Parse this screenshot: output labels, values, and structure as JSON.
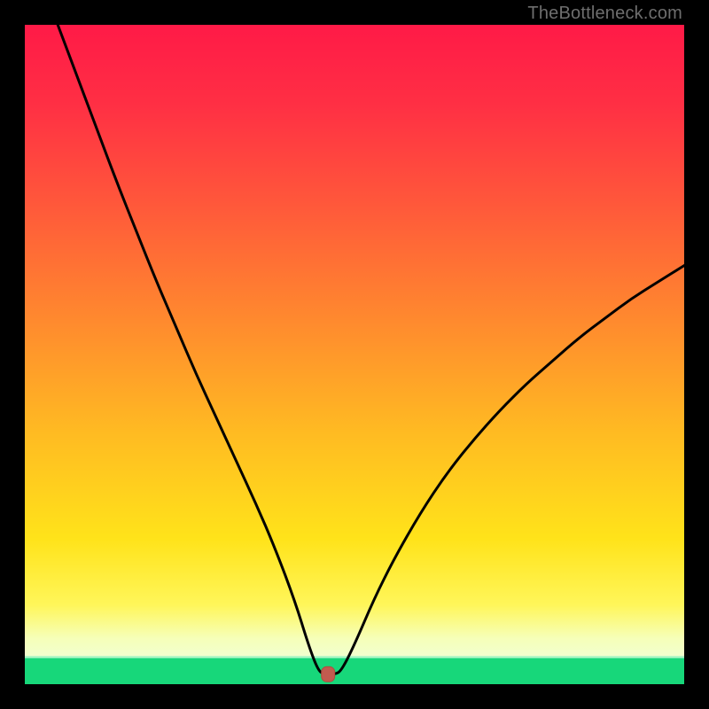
{
  "watermark": "TheBottleneck.com",
  "chart_data": {
    "type": "line",
    "title": "",
    "xlabel": "",
    "ylabel": "",
    "xlim": [
      0,
      100
    ],
    "ylim": [
      0,
      100
    ],
    "grid": false,
    "background_gradient": "red-orange-yellow-green (top→bottom)",
    "green_band_y": [
      0,
      4
    ],
    "marker": {
      "x": 46,
      "y": 1.5,
      "color": "#c15b4f",
      "shape": "rounded-rect"
    },
    "curve_points": [
      {
        "x": 5.0,
        "y": 100.0
      },
      {
        "x": 8.0,
        "y": 92.0
      },
      {
        "x": 11.0,
        "y": 84.0
      },
      {
        "x": 14.0,
        "y": 76.0
      },
      {
        "x": 17.0,
        "y": 68.5
      },
      {
        "x": 20.0,
        "y": 61.0
      },
      {
        "x": 23.0,
        "y": 54.0
      },
      {
        "x": 26.0,
        "y": 47.0
      },
      {
        "x": 29.0,
        "y": 40.5
      },
      {
        "x": 32.0,
        "y": 34.0
      },
      {
        "x": 35.0,
        "y": 27.5
      },
      {
        "x": 38.0,
        "y": 20.5
      },
      {
        "x": 41.0,
        "y": 12.5
      },
      {
        "x": 43.0,
        "y": 6.0
      },
      {
        "x": 44.5,
        "y": 2.0
      },
      {
        "x": 45.5,
        "y": 1.5
      },
      {
        "x": 47.0,
        "y": 1.5
      },
      {
        "x": 48.0,
        "y": 2.0
      },
      {
        "x": 50.0,
        "y": 6.0
      },
      {
        "x": 53.0,
        "y": 13.0
      },
      {
        "x": 56.0,
        "y": 19.0
      },
      {
        "x": 60.0,
        "y": 26.0
      },
      {
        "x": 64.0,
        "y": 32.0
      },
      {
        "x": 68.0,
        "y": 37.0
      },
      {
        "x": 72.0,
        "y": 41.5
      },
      {
        "x": 76.0,
        "y": 45.5
      },
      {
        "x": 80.0,
        "y": 49.0
      },
      {
        "x": 84.0,
        "y": 52.5
      },
      {
        "x": 88.0,
        "y": 55.5
      },
      {
        "x": 92.0,
        "y": 58.5
      },
      {
        "x": 96.0,
        "y": 61.0
      },
      {
        "x": 100.0,
        "y": 63.5
      }
    ]
  }
}
